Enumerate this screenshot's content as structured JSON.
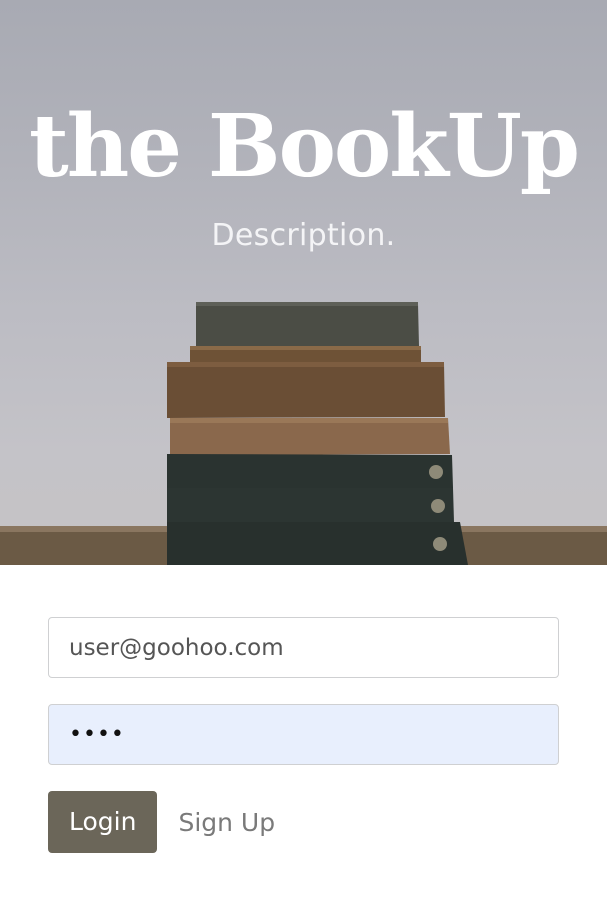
{
  "hero": {
    "title": "the BookUp",
    "description": "Description.",
    "image_icon": "stacked-books-photo"
  },
  "login_form": {
    "email_value": "user@goohoo.com",
    "password_value": "••••",
    "login_label": "Login",
    "signup_label": "Sign Up"
  },
  "colors": {
    "login_button": "#6b6659",
    "password_autofill_bg": "#e8effd",
    "hero_bg": "#b3b4bb"
  }
}
